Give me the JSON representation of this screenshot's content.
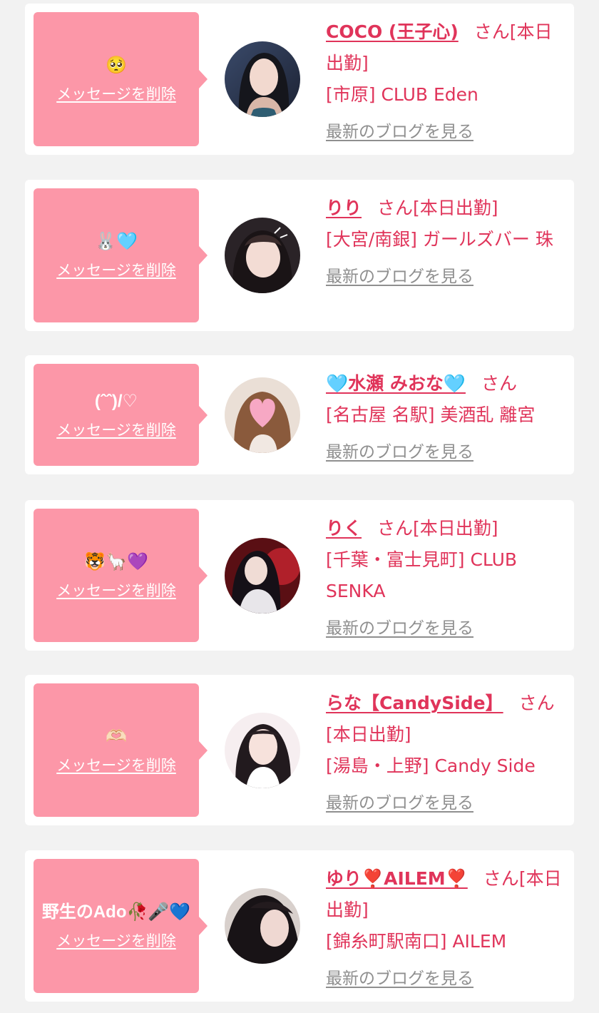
{
  "colors": {
    "background": "#f2f2f2",
    "bubble": "#fc97a8",
    "accent": "#e0345a",
    "link_gray": "#8f8f8f"
  },
  "delete_label": "メッセージを削除",
  "blog_label": "最新のブログを見る",
  "cards": [
    {
      "message": "🥺",
      "name": "COCO (王子心)",
      "honorific": "さん",
      "status": "[本日出勤]",
      "shop": "[市原] CLUB Eden"
    },
    {
      "message": "🐰🩵",
      "name": "りり",
      "honorific": "さん",
      "status": "[本日出勤]",
      "shop": "[大宮/南銀] ガールズバー 珠"
    },
    {
      "message": "(ˆˆ)/♡",
      "name": "🩵水瀬 みおな🩵",
      "honorific": "さん",
      "status": "",
      "shop": "[名古屋 名駅] 美酒乱 離宮"
    },
    {
      "message": "🐯🦙💜",
      "name": "りく",
      "honorific": "さん",
      "status": "[本日出勤]",
      "shop": "[千葉・富士見町] CLUB SENKA"
    },
    {
      "message": "🫶🏻",
      "name": "らな【CandySide】",
      "honorific": "さん",
      "status": "[本日出勤]",
      "shop": "[湯島・上野] Candy Side"
    },
    {
      "message": "野生のAdo🥀🎤💙",
      "name": "ゆり❣️AILEM❣️",
      "honorific": "さん",
      "status": "[本日出勤]",
      "shop": "[錦糸町駅南口] AILEM"
    }
  ]
}
